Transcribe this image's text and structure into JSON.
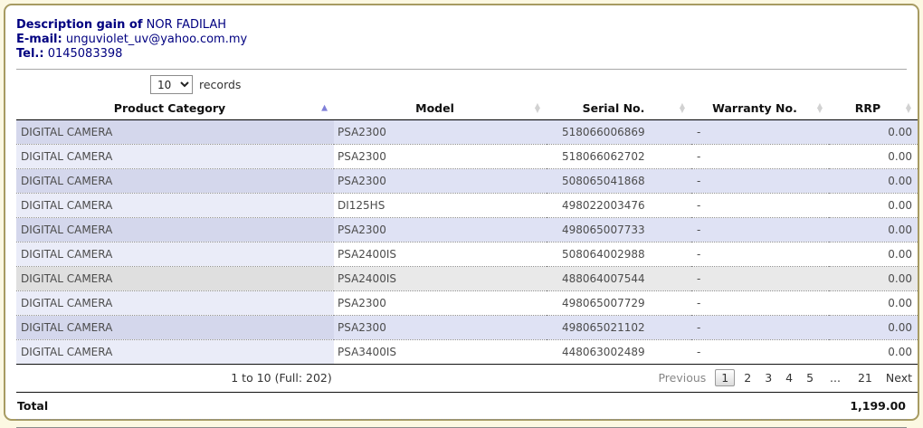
{
  "header": {
    "description_label": "Description gain of",
    "description_value": "NOR FADILAH",
    "email_label": "E-mail:",
    "email_value": "unguviolet_uv@yahoo.com.my",
    "tel_label": "Tel.:",
    "tel_value": "0145083398"
  },
  "length_control": {
    "selected": "10",
    "label": "records"
  },
  "table": {
    "columns": [
      {
        "label": "Product Category",
        "sort": "asc"
      },
      {
        "label": "Model",
        "sort": "none"
      },
      {
        "label": "Serial No.",
        "sort": "none"
      },
      {
        "label": "Warranty No.",
        "sort": "none"
      },
      {
        "label": "RRP",
        "sort": "none"
      }
    ],
    "rows": [
      {
        "cells": [
          "DIGITAL CAMERA",
          "PSA2300",
          "518066006869",
          "-",
          "0.00"
        ]
      },
      {
        "cells": [
          "DIGITAL CAMERA",
          "PSA2300",
          "518066062702",
          "-",
          "0.00"
        ]
      },
      {
        "cells": [
          "DIGITAL CAMERA",
          "PSA2300",
          "508065041868",
          "-",
          "0.00"
        ]
      },
      {
        "cells": [
          "DIGITAL CAMERA",
          "DI125HS",
          "498022003476",
          "-",
          "0.00"
        ]
      },
      {
        "cells": [
          "DIGITAL CAMERA",
          "PSA2300",
          "498065007733",
          "-",
          "0.00"
        ]
      },
      {
        "cells": [
          "DIGITAL CAMERA",
          "PSA2400IS",
          "508064002988",
          "-",
          "0.00"
        ]
      },
      {
        "cells": [
          "DIGITAL CAMERA",
          "PSA2400IS",
          "488064007544",
          "-",
          "0.00"
        ],
        "state": "hover"
      },
      {
        "cells": [
          "DIGITAL CAMERA",
          "PSA2300",
          "498065007729",
          "-",
          "0.00"
        ]
      },
      {
        "cells": [
          "DIGITAL CAMERA",
          "PSA2300",
          "498065021102",
          "-",
          "0.00"
        ]
      },
      {
        "cells": [
          "DIGITAL CAMERA",
          "PSA3400IS",
          "448063002489",
          "-",
          "0.00"
        ]
      }
    ]
  },
  "footer": {
    "info": "1 to 10 (Full: 202)",
    "pagination": {
      "previous_label": "Previous",
      "pages": [
        "1",
        "2",
        "3",
        "4",
        "5"
      ],
      "current_page": "1",
      "ellipsis": "...",
      "last_page": "21",
      "next_label": "Next"
    }
  },
  "total": {
    "label": "Total",
    "value": "1,199.00"
  },
  "colors": {
    "page_background": "#fcf8e2",
    "panel_border": "#a79b62",
    "contact_text": "#000080",
    "odd_row": "#dfe2f4",
    "odd_row_sorted_col": "#d4d7ec",
    "even_row_sorted_col": "#eaecf8",
    "hover_row": "#e9e9e9",
    "sort_asc_icon": "#8080d8",
    "sort_idle_icon": "#d2d2d2",
    "current_page_gradient_top": "#ffffff",
    "current_page_gradient_bottom": "#dcdcdc"
  }
}
